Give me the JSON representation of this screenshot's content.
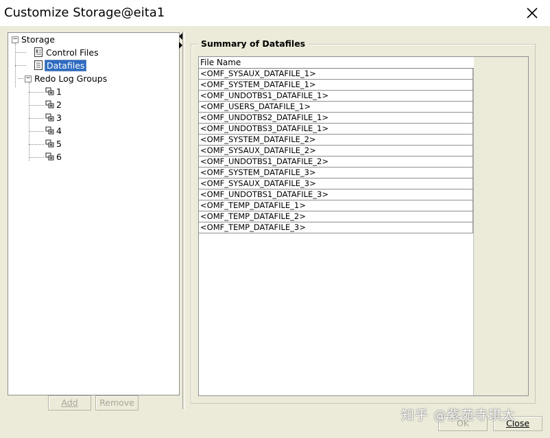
{
  "window": {
    "title": "Customize Storage@eita1"
  },
  "tree": {
    "root": "Storage",
    "children": [
      "Control Files",
      "Datafiles",
      "Redo Log Groups"
    ],
    "redo_groups": [
      "1",
      "2",
      "3",
      "4",
      "5",
      "6"
    ],
    "selected": "Datafiles"
  },
  "buttons": {
    "add": "Add",
    "remove": "Remove",
    "ok": "OK",
    "close": "Close"
  },
  "summary": {
    "title": "Summary of Datafiles",
    "column": "File Name",
    "rows": [
      "<OMF_SYSAUX_DATAFILE_1>",
      "<OMF_SYSTEM_DATAFILE_1>",
      "<OMF_UNDOTBS1_DATAFILE_1>",
      "<OMF_USERS_DATAFILE_1>",
      "<OMF_UNDOTBS2_DATAFILE_1>",
      "<OMF_UNDOTBS3_DATAFILE_1>",
      "<OMF_SYSTEM_DATAFILE_2>",
      "<OMF_SYSAUX_DATAFILE_2>",
      "<OMF_UNDOTBS1_DATAFILE_2>",
      "<OMF_SYSTEM_DATAFILE_3>",
      "<OMF_SYSAUX_DATAFILE_3>",
      "<OMF_UNDOTBS1_DATAFILE_3>",
      "<OMF_TEMP_DATAFILE_1>",
      "<OMF_TEMP_DATAFILE_2>",
      "<OMF_TEMP_DATAFILE_3>"
    ]
  },
  "watermark": "知乎 @紫苑寺琪太",
  "colors": {
    "selection": "#2d6bc1",
    "background": "#ecead9"
  }
}
